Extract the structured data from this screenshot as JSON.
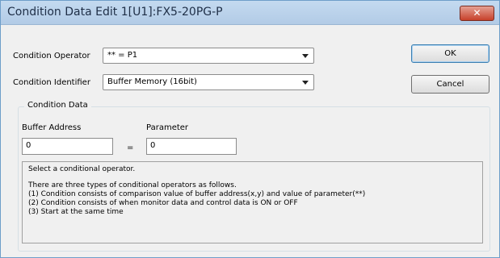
{
  "window": {
    "title": "Condition Data Edit  1[U1]:FX5-20PG-P",
    "close_label": "✕"
  },
  "form": {
    "operator_label": "Condition Operator",
    "operator_value": "** = P1",
    "identifier_label": "Condition Identifier",
    "identifier_value": "Buffer Memory (16bit)"
  },
  "buttons": {
    "ok_label": "OK",
    "cancel_label": "Cancel"
  },
  "condition_data": {
    "group_title": "Condition Data",
    "buffer_address_label": "Buffer Address",
    "buffer_address_value": "0",
    "equals": "=",
    "parameter_label": "Parameter",
    "parameter_value": "0"
  },
  "description": {
    "lines": [
      "Select a conditional operator.",
      "There are three types of conditional operators as follows.",
      "(1) Condition consists of comparison value of buffer address(x,y) and value of parameter(**)",
      "(2) Condition consists of when monitor data and control data is ON or OFF",
      "(3) Start at the same time"
    ]
  },
  "icons": {
    "dropdown_arrow": "chevron-down-icon",
    "close": "close-icon"
  },
  "colors": {
    "titlebar": "#b9d1ea",
    "close_button": "#c7412a",
    "dialog_background": "#f0f0f0"
  }
}
